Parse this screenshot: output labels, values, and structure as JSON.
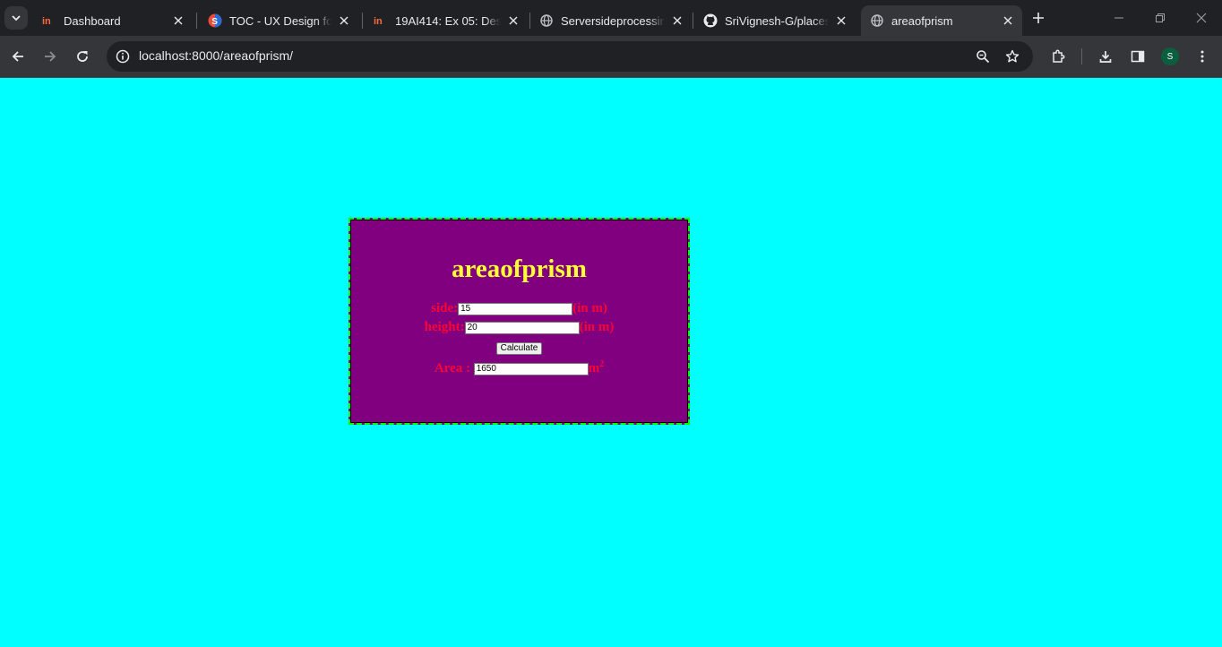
{
  "browser": {
    "tabs": [
      {
        "title": "Dashboard",
        "icon": "invision-icon"
      },
      {
        "title": "TOC - UX Design for V",
        "icon": "skillrack-icon"
      },
      {
        "title": "19AI414: Ex 05: Desig",
        "icon": "invision-icon"
      },
      {
        "title": "Serversideprocessing",
        "icon": "globe-icon"
      },
      {
        "title": "SriVignesh-G/places-",
        "icon": "github-icon"
      },
      {
        "title": "areaofprism",
        "icon": "globe-icon",
        "active": true
      }
    ],
    "url_host": "localhost",
    "url_rest": ":8000/areaofprism/",
    "profile_initial": "S"
  },
  "page": {
    "background": "#00ffff",
    "box_background": "#800080",
    "box_border": "#00ff00",
    "heading": "areaofprism",
    "heading_color": "#ffff33",
    "label_color": "#ff0033",
    "side_label": "side:",
    "side_value": "15",
    "side_unit": "(in m)",
    "height_label": "height:",
    "height_value": "20",
    "height_unit": "(in m)",
    "calculate_label": "Calculate",
    "area_label": "Area :",
    "area_value": "1650",
    "area_unit": "m",
    "area_unit_exp": "2"
  }
}
